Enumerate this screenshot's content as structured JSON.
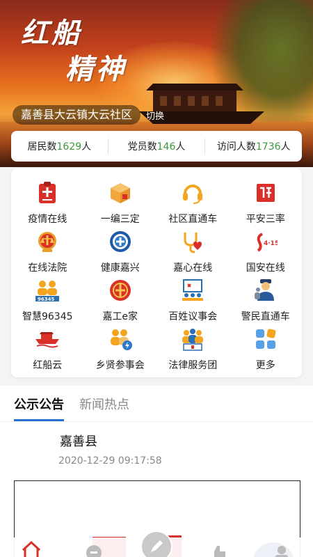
{
  "hero": {
    "art_line1": "红船",
    "art_line2": "精神",
    "location": "嘉善县大云镇大云社区",
    "switch_label": "切换"
  },
  "stats": [
    {
      "label": "居民数",
      "value": "1629",
      "unit": "人"
    },
    {
      "label": "党员数",
      "value": "146",
      "unit": "人"
    },
    {
      "label": "访问人数",
      "value": "1736",
      "unit": "人"
    }
  ],
  "grid": [
    {
      "label": "疫情在线",
      "icon": "epidemic-board-icon"
    },
    {
      "label": "一编三定",
      "icon": "box-icon"
    },
    {
      "label": "社区直通车",
      "icon": "headset-icon"
    },
    {
      "label": "平安三率",
      "icon": "safety-stamp-icon"
    },
    {
      "label": "在线法院",
      "icon": "court-emblem-icon"
    },
    {
      "label": "健康嘉兴",
      "icon": "health-emblem-icon"
    },
    {
      "label": "嘉心在线",
      "icon": "stethoscope-heart-icon"
    },
    {
      "label": "国安在线",
      "icon": "national-security-icon"
    },
    {
      "label": "智慧96345",
      "icon": "people-96345-icon"
    },
    {
      "label": "嘉工e家",
      "icon": "union-emblem-icon"
    },
    {
      "label": "百姓议事会",
      "icon": "meeting-icon"
    },
    {
      "label": "警民直通车",
      "icon": "police-icon"
    },
    {
      "label": "红船云",
      "icon": "red-boat-icon"
    },
    {
      "label": "乡贤参事会",
      "icon": "people-bolt-icon"
    },
    {
      "label": "法律服务团",
      "icon": "legal-team-icon"
    },
    {
      "label": "更多",
      "icon": "more-grid-icon"
    }
  ],
  "tabs": [
    {
      "label": "公示公告",
      "active": true
    },
    {
      "label": "新闻热点",
      "active": false
    }
  ],
  "news": {
    "title": "嘉善县",
    "date": "2020-12-29 09:17:58"
  },
  "colors": {
    "stat_number": "#3a9a3a",
    "tab_underline": "#2a6fd6",
    "accent_red": "#d9302a"
  }
}
